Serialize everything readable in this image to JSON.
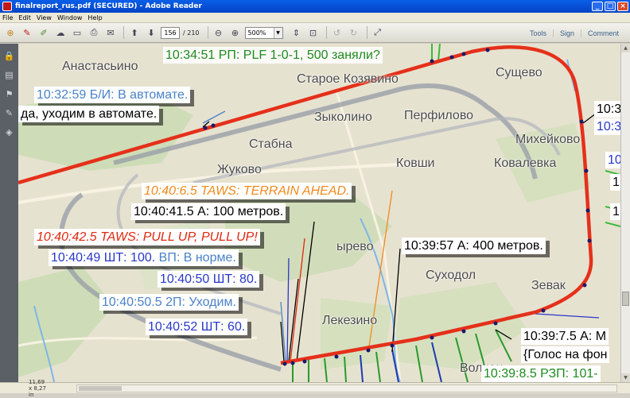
{
  "window": {
    "title": "finalreport_rus.pdf (SECURED) - Adobe Reader",
    "min": "_",
    "max": "□",
    "close": "×"
  },
  "menu": [
    "File",
    "Edit",
    "View",
    "Window",
    "Help"
  ],
  "toolbar": {
    "page_current": "156",
    "page_total": "/ 210",
    "zoom": "500%",
    "links": [
      "Tools",
      "Sign",
      "Comment"
    ]
  },
  "status": {
    "page_size": "11,69 x 8,27 in"
  },
  "map": {
    "places": [
      "Анастасьино",
      "Старое Козявино",
      "Сущево",
      "Зыколино",
      "Перфилово",
      "Стабна",
      "Михейково",
      "Жуково",
      "Ковши",
      "Ковалевка",
      "Суходол",
      "Зевак",
      "Лекезино",
      "Волчон",
      "ырево"
    ],
    "labels": {
      "top": "10:34:51 РП: PLF 1-0-1, 500 заняли?",
      "bi_auto": "10:32:59 Б/И: В автомате.",
      "go_auto": "да, уходим в автомате.",
      "taws_terrain": "10:40:6.5 TAWS: TERRAIN AHEAD.",
      "a100": "10:40:41.5 А: 100 метров.",
      "taws_pull": "10:40:42.5 TAWS: PULL UP, PULL UP!",
      "sht100_a": "10:40:49 ШТ: 100.",
      "sht100_b": "ВП: В норме.",
      "sht80": "10:40:50 ШТ: 80.",
      "p2": "10:40:50.5 2П: Уходим.",
      "sht60": "10:40:52 ШТ: 60.",
      "a400": "10:39:57 А: 400 метров.",
      "a_m": "10:39:7.5 А: М",
      "voice": "{Голос на фон",
      "rzp": "10:39:8.5 РЗП: 101-",
      "edge_r1": "10:3",
      "edge_r2": "10:3",
      "edge_r3": "10",
      "edge_r4": "1",
      "edge_r5": "1"
    }
  }
}
